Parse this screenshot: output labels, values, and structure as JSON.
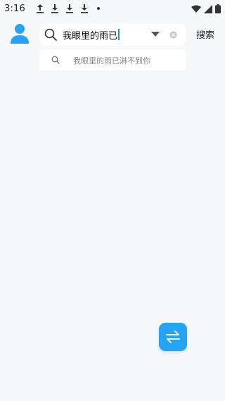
{
  "status_bar": {
    "time": "3:16",
    "left_icons": [
      "upload-icon",
      "download-icon",
      "download-icon",
      "download-icon",
      "dot-icon"
    ],
    "right_icons": [
      "wifi-icon",
      "signal-icon",
      "battery-icon"
    ]
  },
  "header": {
    "avatar_icon": "user-icon",
    "search": {
      "value": "我眼里的雨已",
      "placeholder": "",
      "search_icon": "search-icon",
      "dropdown_icon": "triangle-down-icon",
      "clear_icon": "clear-icon"
    },
    "search_button_label": "搜索"
  },
  "suggestions": [
    {
      "icon": "search-icon",
      "text": "我眼里的雨已淋不到你"
    }
  ],
  "fab": {
    "icon": "swap-arrows-icon"
  },
  "colors": {
    "accent": "#26a4f4",
    "background": "#f6f7f9",
    "caret": "#2a9d8f"
  }
}
